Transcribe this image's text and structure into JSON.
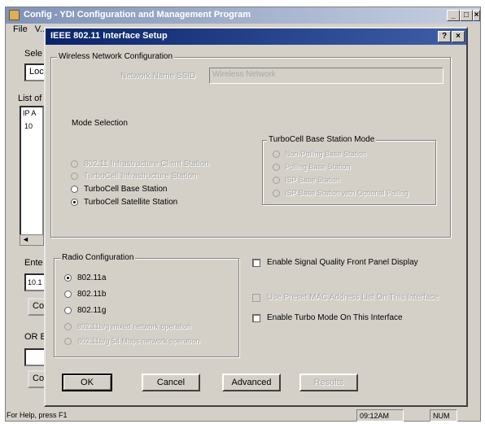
{
  "main_window": {
    "title": "Config - YDI Configuration and Management Program",
    "menu": [
      "File",
      "V..."
    ],
    "fragments": {
      "sel": "Sele",
      "loc": "Loc",
      "listof": "List of",
      "ipa": "IP A",
      "row": "10",
      "ent": "Ente",
      "ipval": "10.1",
      "co1": "Co",
      "ore": "OR E",
      "co2": "Co"
    },
    "min_glyph": "_",
    "max_glyph": "□",
    "close_glyph": "×"
  },
  "status_bar": {
    "help": "For Help, press F1",
    "time": "09:12AM",
    "num": "NUM"
  },
  "dialog": {
    "title": "IEEE 802.11 Interface Setup",
    "help_glyph": "?",
    "close_glyph": "×",
    "wireless_group": {
      "label": "Wireless Network Configuration",
      "network_name_label": "Network Name SSID",
      "network_name_value": "Wireless Network",
      "mode_selection_label": "Mode Selection",
      "modes": [
        {
          "label": "802.11 Infrastructure Client Station",
          "selected": false,
          "enabled": false
        },
        {
          "label": "TurboCell Infrastructure Station",
          "selected": false,
          "enabled": false
        },
        {
          "label": "TurboCell Base Station",
          "selected": false,
          "enabled": true
        },
        {
          "label": "TurboCell Satellite Station",
          "selected": true,
          "enabled": true
        }
      ],
      "base_mode_group": {
        "label": "TurboCell Base Station Mode",
        "options": [
          "Non-Polling Base Station",
          "Polling Base Station",
          "ISP Base Station",
          "ISP Base Station with Optional Polling"
        ]
      }
    },
    "radio_group": {
      "label": "Radio Configuration",
      "options": [
        {
          "label": "802.11a",
          "selected": true,
          "enabled": true
        },
        {
          "label": "802.11b",
          "selected": false,
          "enabled": true
        },
        {
          "label": "802.11g",
          "selected": false,
          "enabled": true
        },
        {
          "label": "802.11b/g mixed network operation",
          "selected": false,
          "enabled": false
        },
        {
          "label": "802.11b/g 54 Mbps network operation",
          "selected": false,
          "enabled": false
        }
      ]
    },
    "checkboxes": {
      "signal_quality": "Enable Signal Quality Front Panel Display",
      "mac_filter": "Use Preset MAC Address List On This Interface",
      "turbo_mode": "Enable Turbo Mode On This Interface"
    },
    "buttons": {
      "ok": "OK",
      "cancel": "Cancel",
      "advanced": "Advanced",
      "results": "Results"
    }
  }
}
